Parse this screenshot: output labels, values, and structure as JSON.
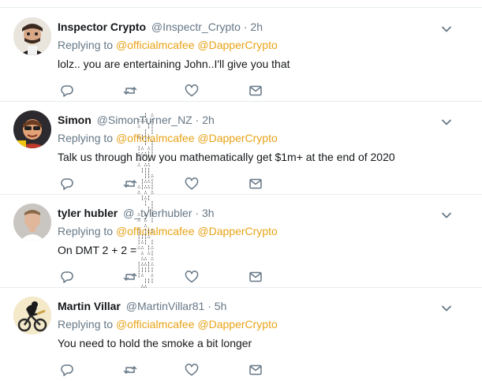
{
  "tweets": [
    {
      "name": "Inspector Crypto",
      "handle": "@Inspectr_Crypto",
      "time": "2h",
      "replying_prefix": "Replying to ",
      "mentions": [
        "@officialmcafee",
        "@DapperCrypto"
      ],
      "text": "lolz.. you are entertaining John..I'll give you that"
    },
    {
      "name": "Simon",
      "handle": "@SimonTurner_NZ",
      "time": "2h",
      "replying_prefix": "Replying to ",
      "mentions": [
        "@officialmcafee",
        "@DapperCrypto"
      ],
      "text": "Talk us through how you mathematically get $1m+ at the end of 2020"
    },
    {
      "name": "tyler hubler",
      "handle": "@_tylerhubler",
      "time": "3h",
      "replying_prefix": "Replying to ",
      "mentions": [
        "@officialmcafee",
        "@DapperCrypto"
      ],
      "text": "On DMT 2 + 2 = "
    },
    {
      "name": "Martin Villar",
      "handle": "@MartinVillar81",
      "time": "5h",
      "replying_prefix": "Replying to ",
      "mentions": [
        "@officialmcafee",
        "@DapperCrypto"
      ],
      "text": "You need to hold the smoke a bit longer"
    }
  ],
  "separator": "·",
  "icons": [
    "reply-icon",
    "retweet-icon",
    "like-icon",
    "direct-message-icon",
    "chevron-down-icon"
  ],
  "colors": {
    "mention": "#e8a317",
    "muted": "#657786",
    "text": "#14171a",
    "border": "#e6ecf0"
  }
}
